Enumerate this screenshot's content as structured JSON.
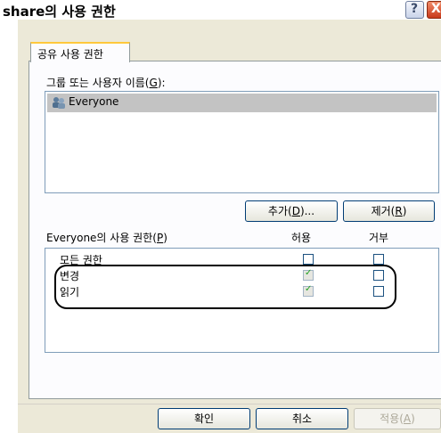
{
  "window": {
    "title": "share의 사용 권한",
    "help_glyph": "?",
    "close_glyph": "X"
  },
  "tab": {
    "label": "공유 사용 권한"
  },
  "group_section": {
    "label_prefix": "그룹 또는 사용자 이름(",
    "label_key": "G",
    "label_suffix": "):",
    "users": [
      "Everyone"
    ]
  },
  "buttons": {
    "add_prefix": "추가(",
    "add_key": "D",
    "add_suffix": ")...",
    "remove_prefix": "제거(",
    "remove_key": "R",
    "remove_suffix": ")",
    "ok": "확인",
    "cancel": "취소",
    "apply_prefix": "적용(",
    "apply_key": "A",
    "apply_suffix": ")"
  },
  "permissions": {
    "label_prefix": "Everyone의 사용 권한(",
    "label_key": "P",
    "label_suffix": ")",
    "allow_header": "허용",
    "deny_header": "거부",
    "rows": [
      {
        "name": "모든 권한",
        "allow": false,
        "deny": false
      },
      {
        "name": "변경",
        "allow": true,
        "deny": false
      },
      {
        "name": "읽기",
        "allow": true,
        "deny": false
      }
    ]
  }
}
